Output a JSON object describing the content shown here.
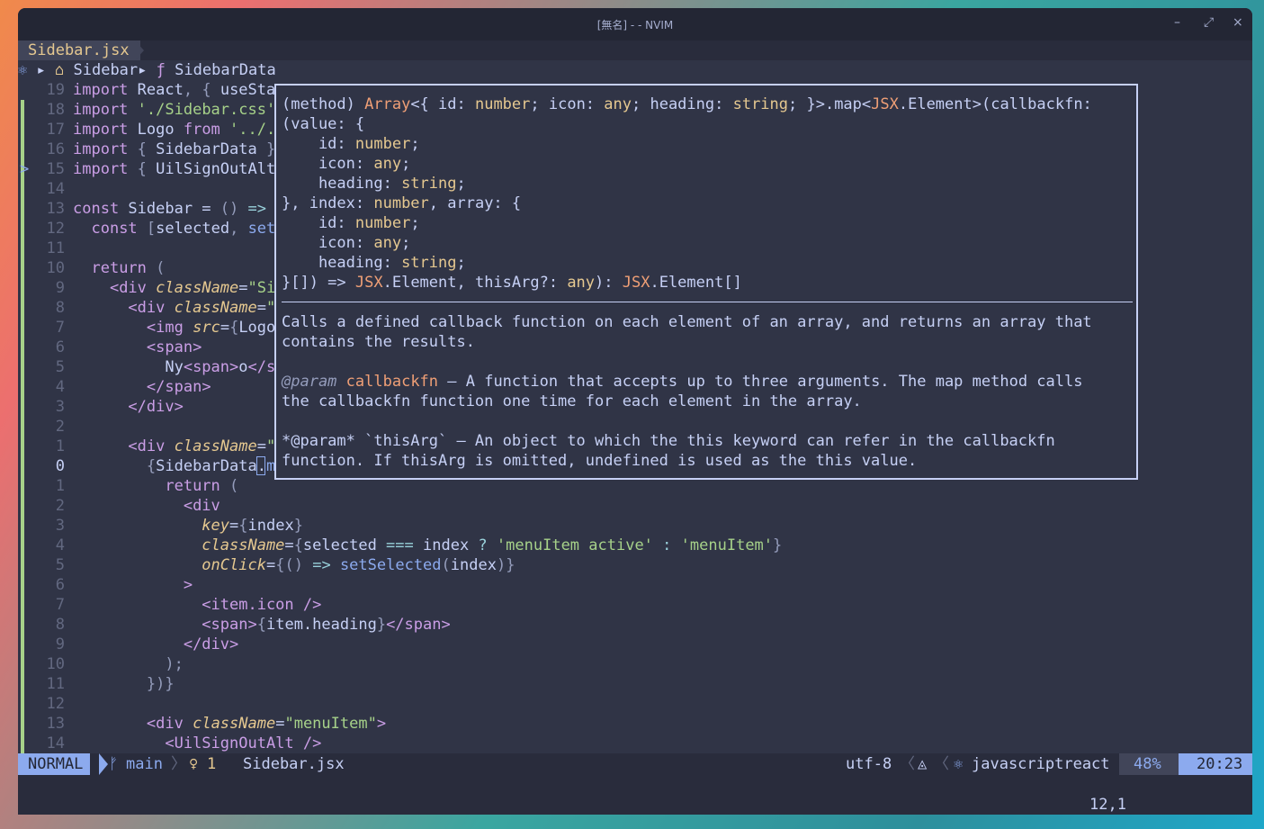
{
  "window": {
    "title": "[無名] - - NVIM",
    "buttons": [
      "–",
      "⤢",
      "×"
    ]
  },
  "tab": {
    "label": "Sidebar.jsx"
  },
  "winbar": {
    "file": "Sidebar",
    "symbol": "SidebarData"
  },
  "lines": [
    {
      "n": "19",
      "t": "import React, { useSta"
    },
    {
      "n": "18",
      "t": "import './Sidebar.css'"
    },
    {
      "n": "17",
      "t": "import Logo from '../."
    },
    {
      "n": "16",
      "t": "import { SidebarData }"
    },
    {
      "n": "15",
      "t": "import { UilSignOutAlt"
    },
    {
      "n": "14",
      "t": ""
    },
    {
      "n": "13",
      "t": "const Sidebar = () =>"
    },
    {
      "n": "12",
      "t": "  const [selected, set"
    },
    {
      "n": "11",
      "t": ""
    },
    {
      "n": "10",
      "t": "  return ("
    },
    {
      "n": "9",
      "t": "    <div className=\"Si"
    },
    {
      "n": "8",
      "t": "      <div className=\""
    },
    {
      "n": "7",
      "t": "        <img src={Logo"
    },
    {
      "n": "6",
      "t": "        <span>"
    },
    {
      "n": "5",
      "t": "          Ny<span>o</s"
    },
    {
      "n": "4",
      "t": "        </span>"
    },
    {
      "n": "3",
      "t": "      </div>"
    },
    {
      "n": "2",
      "t": ""
    },
    {
      "n": "1",
      "t": "      <div className=\""
    },
    {
      "n": "0",
      "t": "        {SidebarData.map((item, index) => {"
    },
    {
      "n": "1",
      "t": "          return ("
    },
    {
      "n": "2",
      "t": "            <div"
    },
    {
      "n": "3",
      "t": "              key={index}"
    },
    {
      "n": "4",
      "t": "              className={selected === index ? 'menuItem active' : 'menuItem'}"
    },
    {
      "n": "5",
      "t": "              onClick={() => setSelected(index)}"
    },
    {
      "n": "6",
      "t": "            >"
    },
    {
      "n": "7",
      "t": "              <item.icon />"
    },
    {
      "n": "8",
      "t": "              <span>{item.heading}</span>"
    },
    {
      "n": "9",
      "t": "            </div>"
    },
    {
      "n": "10",
      "t": "          );"
    },
    {
      "n": "11",
      "t": "        })}"
    },
    {
      "n": "12",
      "t": ""
    },
    {
      "n": "13",
      "t": "        <div className=\"menuItem\">"
    },
    {
      "n": "14",
      "t": "          <UilSignOutAlt />"
    }
  ],
  "hover": {
    "signature": [
      "(method) Array<{ id: number; icon: any; heading: string; }>.map<JSX.Element>(callbackfn:",
      "(value: {",
      "    id: number;",
      "    icon: any;",
      "    heading: string;",
      "}, index: number, array: {",
      "    id: number;",
      "    icon: any;",
      "    heading: string;",
      "}[]) => JSX.Element, thisArg?: any): JSX.Element[]"
    ],
    "doc": [
      "Calls a defined callback function on each element of an array, and returns an array that",
      "contains the results.",
      "",
      "@param callbackfn — A function that accepts up to three arguments. The map method calls",
      "the callbackfn function one time for each element in the array.",
      "",
      "*@param* `thisArg` — An object to which the this keyword can refer in the callbackfn",
      "function. If thisArg is omitted, undefined is used as the this value."
    ]
  },
  "status": {
    "mode": "NORMAL",
    "branch": "main",
    "diagnostics": "1",
    "file": "Sidebar.jsx",
    "encoding": "utf-8",
    "filetype": "javascriptreact",
    "percent": "48%",
    "position": "20:23"
  },
  "cmdline": {
    "ruler": "12,1"
  }
}
